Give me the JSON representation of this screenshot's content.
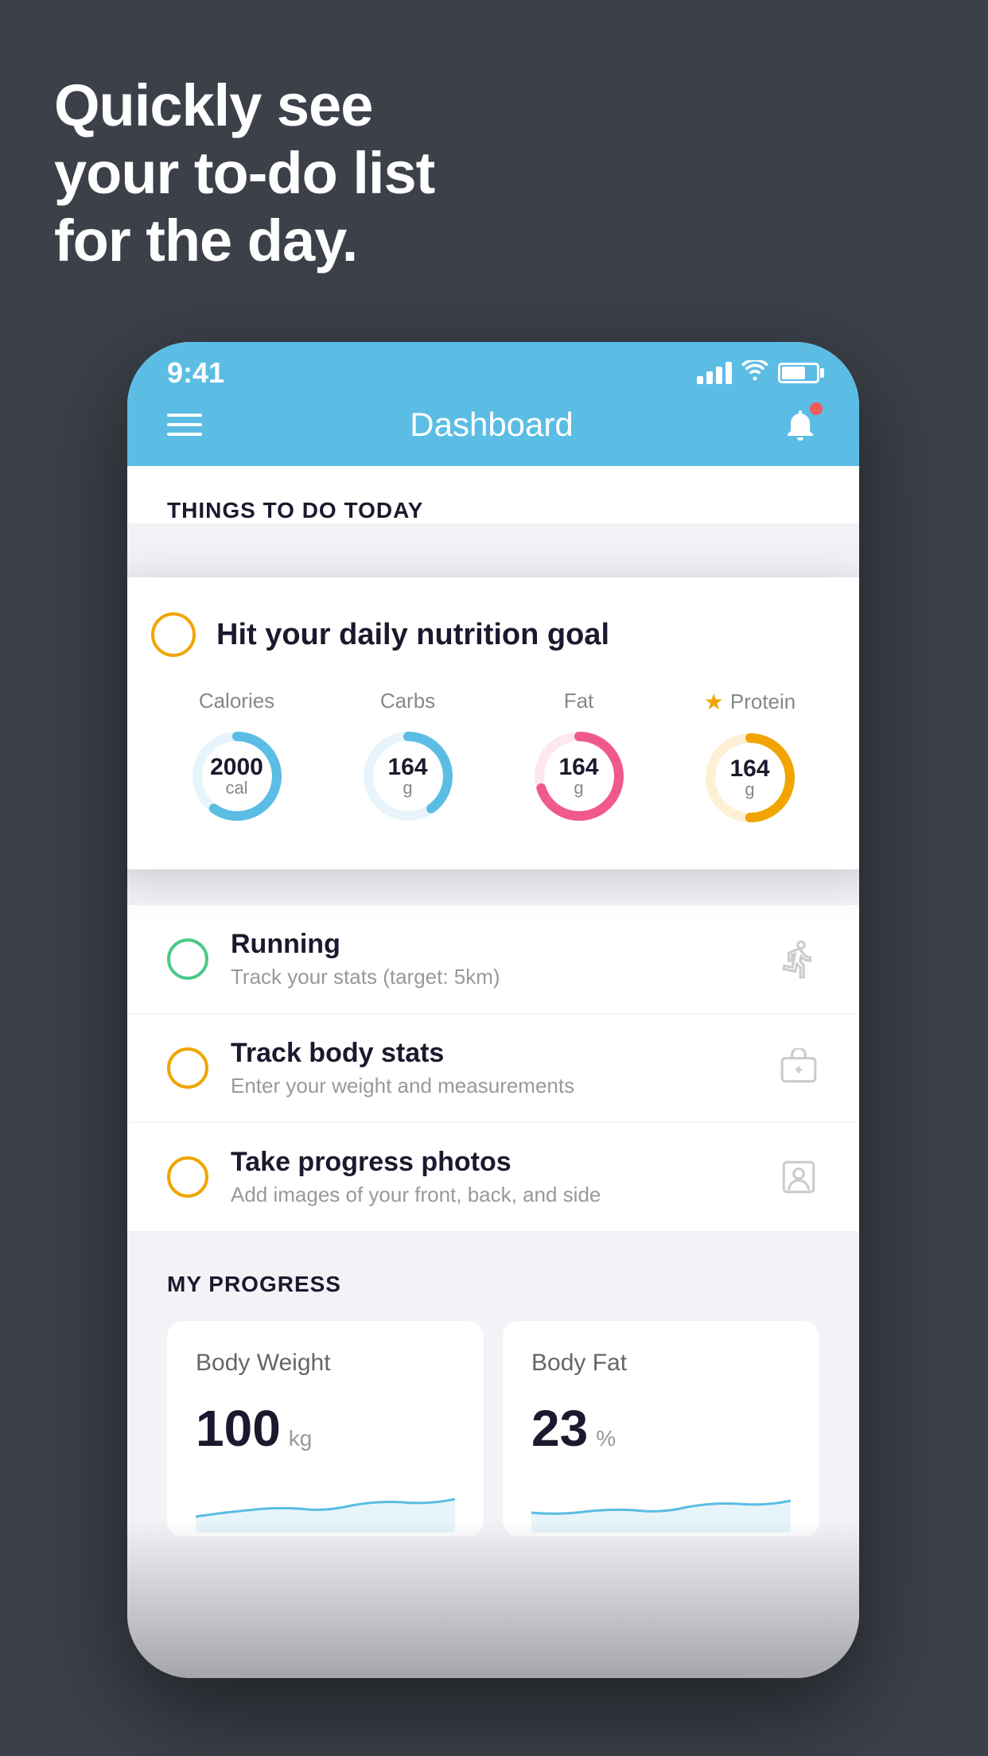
{
  "hero": {
    "line1": "Quickly see",
    "line2": "your to-do list",
    "line3": "for the day."
  },
  "status_bar": {
    "time": "9:41"
  },
  "nav": {
    "title": "Dashboard"
  },
  "things_section": {
    "heading": "THINGS TO DO TODAY"
  },
  "floating_card": {
    "title": "Hit your daily nutrition goal",
    "nutrients": [
      {
        "label": "Calories",
        "value": "2000",
        "unit": "cal",
        "color": "#5bbde4",
        "track": 0.6,
        "starred": false
      },
      {
        "label": "Carbs",
        "value": "164",
        "unit": "g",
        "color": "#5bbde4",
        "track": 0.4,
        "starred": false
      },
      {
        "label": "Fat",
        "value": "164",
        "unit": "g",
        "color": "#f05a8a",
        "track": 0.7,
        "starred": false
      },
      {
        "label": "Protein",
        "value": "164",
        "unit": "g",
        "color": "#f0a500",
        "track": 0.5,
        "starred": true
      }
    ]
  },
  "todo_items": [
    {
      "name": "Running",
      "sub": "Track your stats (target: 5km)",
      "circle_color": "green",
      "icon": "shoe"
    },
    {
      "name": "Track body stats",
      "sub": "Enter your weight and measurements",
      "circle_color": "yellow",
      "icon": "scale"
    },
    {
      "name": "Take progress photos",
      "sub": "Add images of your front, back, and side",
      "circle_color": "yellow",
      "icon": "person"
    }
  ],
  "progress": {
    "title": "MY PROGRESS",
    "cards": [
      {
        "title": "Body Weight",
        "value": "100",
        "unit": "kg"
      },
      {
        "title": "Body Fat",
        "value": "23",
        "unit": "%"
      }
    ]
  }
}
